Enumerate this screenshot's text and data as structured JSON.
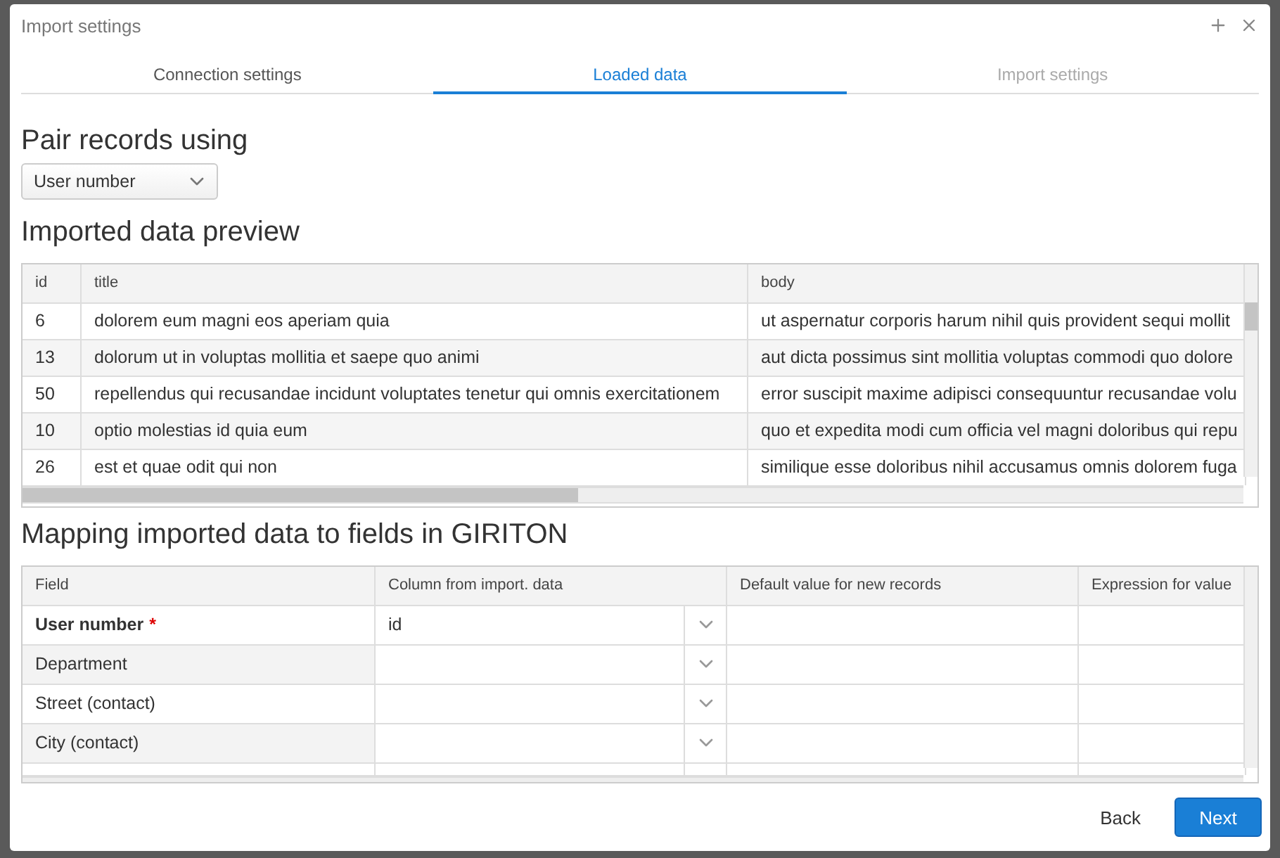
{
  "dialog": {
    "title": "Import settings"
  },
  "tabs": [
    {
      "label": "Connection settings",
      "selected": false,
      "disabled": false
    },
    {
      "label": "Loaded data",
      "selected": true,
      "disabled": false
    },
    {
      "label": "Import settings",
      "selected": false,
      "disabled": true
    }
  ],
  "pairing": {
    "heading": "Pair records using",
    "select": {
      "value": "User number"
    }
  },
  "preview": {
    "heading": "Imported data preview",
    "columns": [
      "id",
      "title",
      "body"
    ],
    "rows": [
      [
        "6",
        "dolorem eum magni eos aperiam quia",
        "ut aspernatur corporis harum nihil quis provident sequi mollit"
      ],
      [
        "13",
        "dolorum ut in voluptas mollitia et saepe quo animi",
        "aut dicta possimus sint mollitia voluptas commodi quo dolore"
      ],
      [
        "50",
        "repellendus qui recusandae incidunt voluptates tenetur qui omnis exercitationem",
        "error suscipit maxime adipisci consequuntur recusandae volu"
      ],
      [
        "10",
        "optio molestias id quia eum",
        "quo et expedita modi cum officia vel magni doloribus qui repu"
      ],
      [
        "26",
        "est et quae odit qui non",
        "similique esse doloribus nihil accusamus omnis dolorem fuga"
      ]
    ]
  },
  "mapping": {
    "heading": "Mapping imported data to fields in GIRITON",
    "required_marker": "*",
    "columns": [
      "Field",
      "Column from import. data",
      "Default value for new records",
      "Expression for value"
    ],
    "rows": [
      {
        "field": "User number",
        "required": true,
        "column": "id"
      },
      {
        "field": "Department",
        "required": false
      },
      {
        "field": "Street (contact)",
        "required": false
      },
      {
        "field": "City (contact)",
        "required": false
      }
    ]
  },
  "buttons": {
    "back": "Back",
    "next": "Next"
  }
}
